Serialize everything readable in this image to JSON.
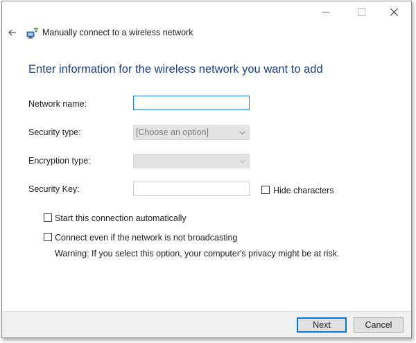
{
  "window": {
    "title": "Manually connect to a wireless network"
  },
  "page": {
    "heading": "Enter information for the wireless network you want to add"
  },
  "form": {
    "network_name": {
      "label": "Network name:",
      "value": ""
    },
    "security_type": {
      "label": "Security type:",
      "selected": "[Choose an option]"
    },
    "encryption_type": {
      "label": "Encryption type:",
      "selected": ""
    },
    "security_key": {
      "label": "Security Key:",
      "value": ""
    },
    "hide_characters": {
      "label": "Hide characters",
      "checked": false
    }
  },
  "options": {
    "start_auto": {
      "label": "Start this connection automatically",
      "checked": false
    },
    "connect_not_broadcasting": {
      "label": "Connect even if the network is not broadcasting",
      "checked": false
    },
    "warning": "Warning: If you select this option, your computer's privacy might be at risk."
  },
  "buttons": {
    "next": "Next",
    "cancel": "Cancel"
  },
  "icons": {
    "back": "back-arrow-icon",
    "network": "network-icon",
    "minimize": "minimize-icon",
    "maximize": "maximize-icon",
    "close": "close-icon"
  },
  "colors": {
    "heading": "#1a3f8a",
    "focus_border": "#1e7bd4",
    "primary_button_border": "#0078d7"
  }
}
